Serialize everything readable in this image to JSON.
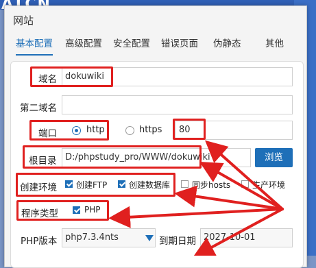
{
  "background": {
    "logo_text": "ATCN"
  },
  "dialog": {
    "title": "网站"
  },
  "tabs": [
    {
      "label": "基本配置",
      "active": true
    },
    {
      "label": "高级配置",
      "active": false
    },
    {
      "label": "安全配置",
      "active": false
    },
    {
      "label": "错误页面",
      "active": false
    },
    {
      "label": "伪静态",
      "active": false
    },
    {
      "label": "其他",
      "active": false
    }
  ],
  "form": {
    "domain": {
      "label": "域名",
      "value": "dokuwiki"
    },
    "second_domain": {
      "label": "第二域名",
      "value": ""
    },
    "port": {
      "label": "端口",
      "http_label": "http",
      "https_label": "https",
      "selected": "http",
      "value": "80"
    },
    "root": {
      "label": "根目录",
      "value": "D:/phpstudy_pro/WWW/dokuwiki",
      "browse_label": "浏览"
    },
    "env": {
      "label": "创建环境",
      "options": [
        {
          "label": "创建FTP",
          "checked": true
        },
        {
          "label": "创建数据库",
          "checked": true
        },
        {
          "label": "同步hosts",
          "checked": false
        },
        {
          "label": "生产环境",
          "checked": false
        }
      ]
    },
    "program_type": {
      "label": "程序类型",
      "option": {
        "label": "PHP",
        "checked": true
      }
    },
    "php_version": {
      "label": "PHP版本",
      "value": "php7.3.4nts"
    },
    "expire": {
      "label": "到期日期",
      "value": "2027-10-01"
    }
  },
  "colors": {
    "accent": "#1e6fb8",
    "annotation": "#e0201f"
  }
}
